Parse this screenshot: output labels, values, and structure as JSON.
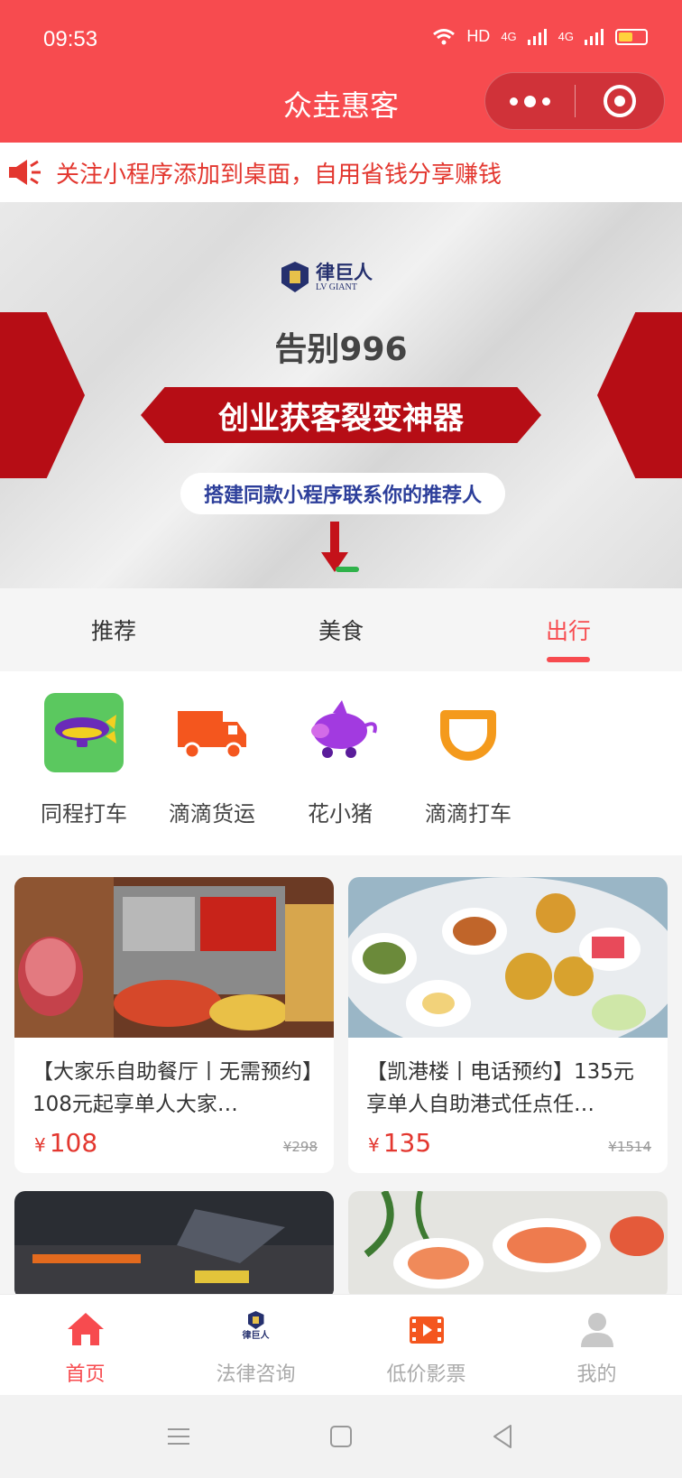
{
  "status_bar": {
    "time": "09:53",
    "network": "HD",
    "signal_1": "4G",
    "signal_2": "4G",
    "battery_level": 0.55
  },
  "header": {
    "title": "众垚惠客",
    "more_icon": "more-dots-icon",
    "close_icon": "target-close-icon"
  },
  "notice": {
    "icon": "megaphone-icon",
    "text": "关注小程序添加到桌面，自用省钱分享赚钱"
  },
  "banner": {
    "logo_cn": "律巨人",
    "logo_en": "LV GIANT",
    "headline": "告别996",
    "ribbon": "创业获客裂变神器",
    "sub": "搭建同款小程序联系你的推荐人"
  },
  "tabs": [
    {
      "label": "推荐",
      "active": false
    },
    {
      "label": "美食",
      "active": false
    },
    {
      "label": "出行",
      "active": true
    }
  ],
  "categories": [
    {
      "label": "同程打车",
      "icon": "airship-icon"
    },
    {
      "label": "滴滴货运",
      "icon": "truck-icon"
    },
    {
      "label": "花小猪",
      "icon": "pig-icon"
    },
    {
      "label": "滴滴打车",
      "icon": "didi-icon"
    }
  ],
  "products": [
    {
      "title": "【大家乐自助餐厅丨无需预约】108元起享单人大家…",
      "currency": "¥",
      "price": "108",
      "original": "¥298"
    },
    {
      "title": "【凯港楼丨电话预约】135元享单人自助港式任点任…",
      "currency": "¥",
      "price": "135",
      "original": "¥1514"
    }
  ],
  "tabbar": [
    {
      "label": "首页",
      "icon": "home-icon",
      "active": true
    },
    {
      "label": "法律咨询",
      "icon": "lvjuren-logo-icon",
      "active": false
    },
    {
      "label": "低价影票",
      "icon": "film-icon",
      "active": false
    },
    {
      "label": "我的",
      "icon": "user-icon",
      "active": false
    }
  ],
  "tabbar_logo_text": "律巨人",
  "colors": {
    "brand": "#f74b4f",
    "price": "#e3372f",
    "ribbon": "#b60d15"
  }
}
